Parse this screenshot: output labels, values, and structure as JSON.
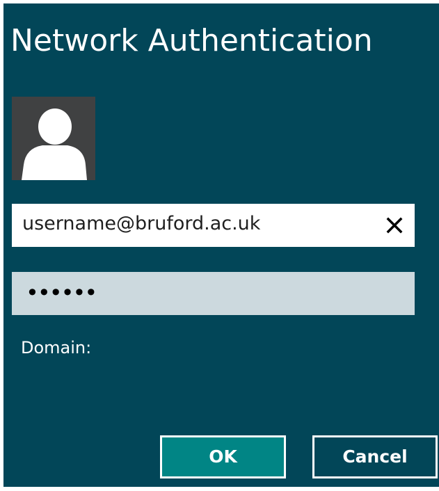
{
  "dialog": {
    "title": "Network Authentication",
    "username_value": "username@bruford.ac.uk",
    "password_mask": "••••••",
    "domain_label": "Domain:",
    "ok_label": "OK",
    "cancel_label": "Cancel",
    "avatar_icon": "user-avatar-icon",
    "clear_icon": "close-icon"
  },
  "colors": {
    "background": "#024658",
    "ok_button": "#018585",
    "password_field": "#ccd9de",
    "avatar_bg": "#404142"
  }
}
